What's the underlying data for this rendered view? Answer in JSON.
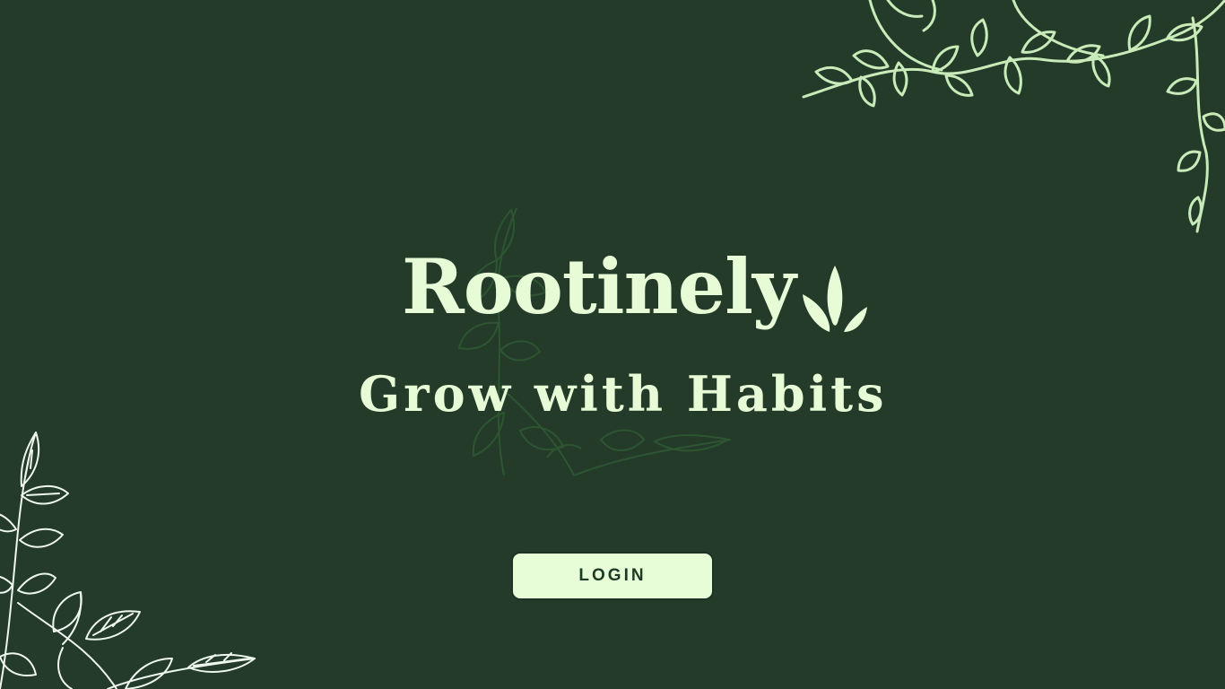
{
  "brand": {
    "name": "Rootinely",
    "logo_icon": "leaf-sprout-icon"
  },
  "hero": {
    "tagline": "Grow with Habits"
  },
  "actions": {
    "login_label": "LOGIN"
  },
  "decorations": {
    "top_right": "leafy-vine-illustration",
    "bottom_left": "leafy-plant-illustration",
    "center": "faded-plant-watermark"
  },
  "colors": {
    "background": "#243b29",
    "text_primary": "#e6fbd6",
    "button_bg": "#e6fdd8",
    "button_text": "#1f3a24",
    "vine": "#c8ebb9",
    "watermark": "#2e5a33"
  }
}
